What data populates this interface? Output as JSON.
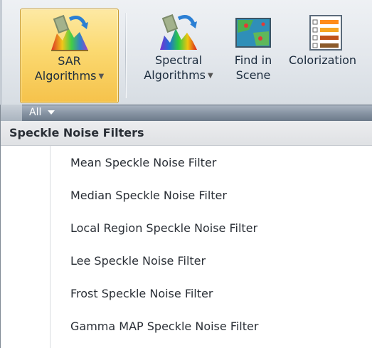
{
  "ribbon": {
    "buttons": [
      {
        "line1": "SAR",
        "line2": "Algorithms",
        "has_dropdown": true,
        "icon": "sar-algorithms-icon"
      },
      {
        "line1": "Spectral",
        "line2": "Algorithms",
        "has_dropdown": true,
        "icon": "spectral-algorithms-icon"
      },
      {
        "line1": "Find in",
        "line2": "Scene",
        "has_dropdown": false,
        "icon": "find-in-scene-icon"
      },
      {
        "line1": "Colorization",
        "line2": "",
        "has_dropdown": false,
        "icon": "colorization-icon"
      }
    ]
  },
  "dropdown": {
    "filter_label": "All",
    "group_title": "Speckle Noise Filters",
    "items": [
      "Mean Speckle Noise Filter",
      "Median Speckle Noise Filter",
      "Local Region Speckle Noise Filter",
      "Lee Speckle Noise Filter",
      "Frost Speckle Noise Filter",
      "Gamma MAP Speckle Noise Filter"
    ]
  },
  "colors": {
    "active_button": "#fbd970",
    "filter_bar": "#8794a3",
    "text": "#2a2f36"
  }
}
